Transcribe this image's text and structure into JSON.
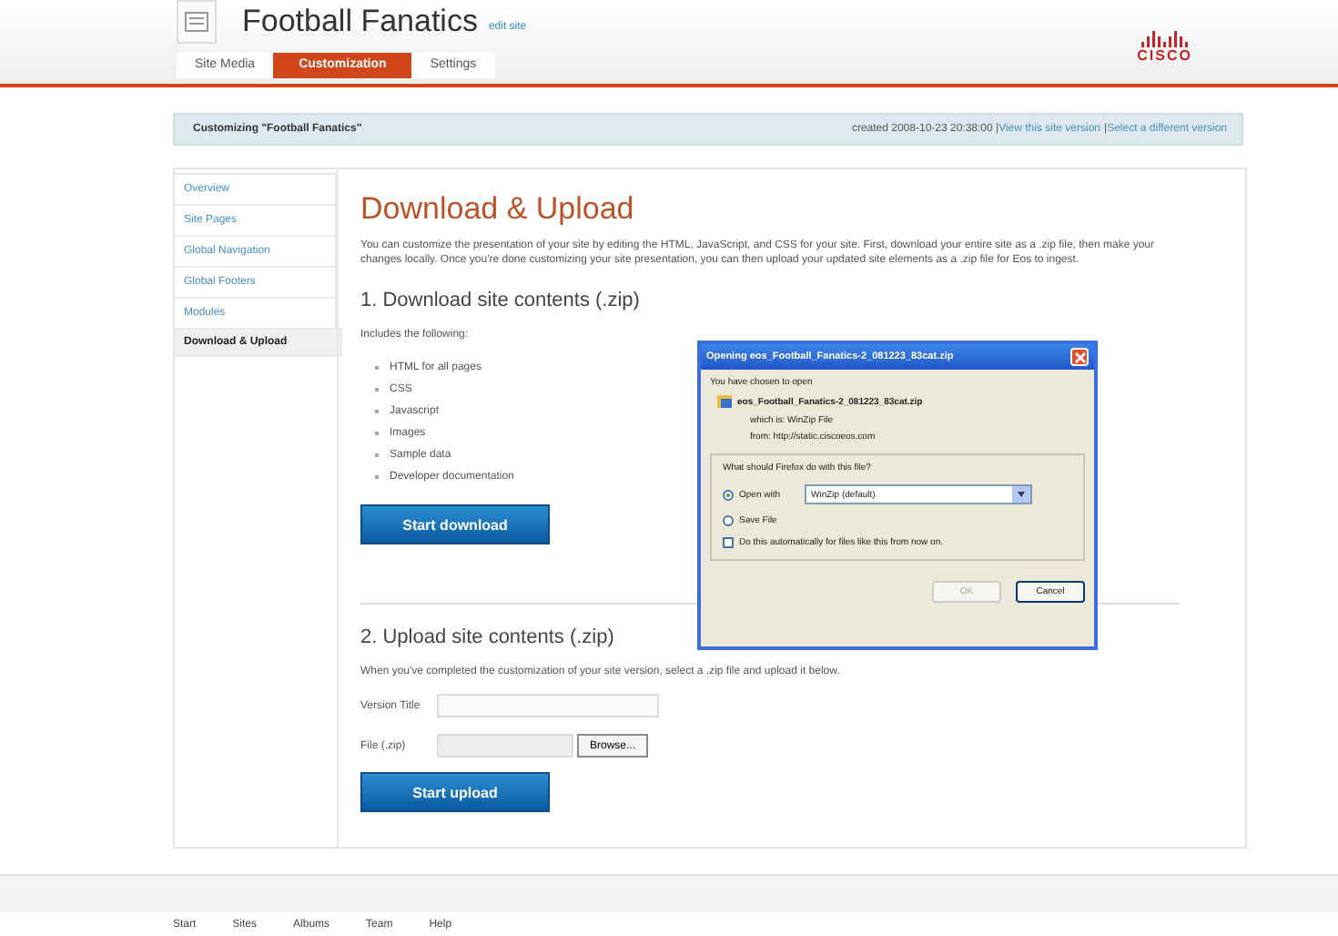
{
  "header": {
    "title": "Football Fanatics",
    "edit_link": "edit site",
    "logo_text": "CISCO"
  },
  "tabs": [
    {
      "label": "Site Media",
      "selected": false
    },
    {
      "label": "Customization",
      "selected": true
    },
    {
      "label": "Settings",
      "selected": false
    }
  ],
  "customizing_bar": {
    "title": "Customizing \"Football Fanatics\"",
    "created": "created 2008-10-23 20:38:00 |",
    "view_link": "View this site version",
    "separator": "|",
    "select_link": "Select a different version"
  },
  "sidebar": {
    "items": [
      {
        "label": "Overview",
        "selected": false
      },
      {
        "label": "Site Pages",
        "selected": false
      },
      {
        "label": "Global Navigation",
        "selected": false
      },
      {
        "label": "Global Footers",
        "selected": false
      },
      {
        "label": "Modules",
        "selected": false
      },
      {
        "label": "Download & Upload",
        "selected": true
      }
    ]
  },
  "main": {
    "heading": "Download & Upload",
    "intro": "You can customize the presentation of your site by editing the HTML, JavaScript, and CSS for your site. First, download your entire site as a .zip file, then make your changes locally. Once you're done customizing your site presentation, you can then upload your updated site elements as a .zip file for Eos to ingest.",
    "download": {
      "heading": "1. Download site contents (.zip)",
      "includes": "Includes the following:",
      "items": [
        "HTML for all pages",
        "CSS",
        "Javascript",
        "Images",
        "Sample data",
        "Developer documentation"
      ],
      "button": "Start download"
    },
    "upload": {
      "heading": "2. Upload site contents (.zip)",
      "text": "When you've completed the customization of your site version, select a .zip file and upload it below.",
      "version_label": "Version Title",
      "file_label": "File (.zip)",
      "browse": "Browse...",
      "button": "Start upload"
    }
  },
  "dialog": {
    "title": "Opening eos_Football_Fanatics-2_081223_83cat.zip",
    "chosen": "You have chosen to open",
    "filename": "eos_Football_Fanatics-2_081223_83cat.zip",
    "which_is": "which is: WinZip File",
    "from": "from: http://static.ciscoeos.com",
    "legend": "What should Firefox do with this file?",
    "options": [
      {
        "label": "Open with",
        "selected": true
      },
      {
        "label": "Save File",
        "selected": false
      }
    ],
    "open_with_value": "WinZip (default)",
    "auto": {
      "label": "Do this automatically for files like this from now on.",
      "checked": false
    },
    "buttons": [
      {
        "label": "OK",
        "disabled": true
      },
      {
        "label": "Cancel",
        "disabled": false
      }
    ]
  },
  "footer": {
    "links": [
      "Start",
      "Sites",
      "Albums",
      "Team",
      "Help"
    ]
  }
}
